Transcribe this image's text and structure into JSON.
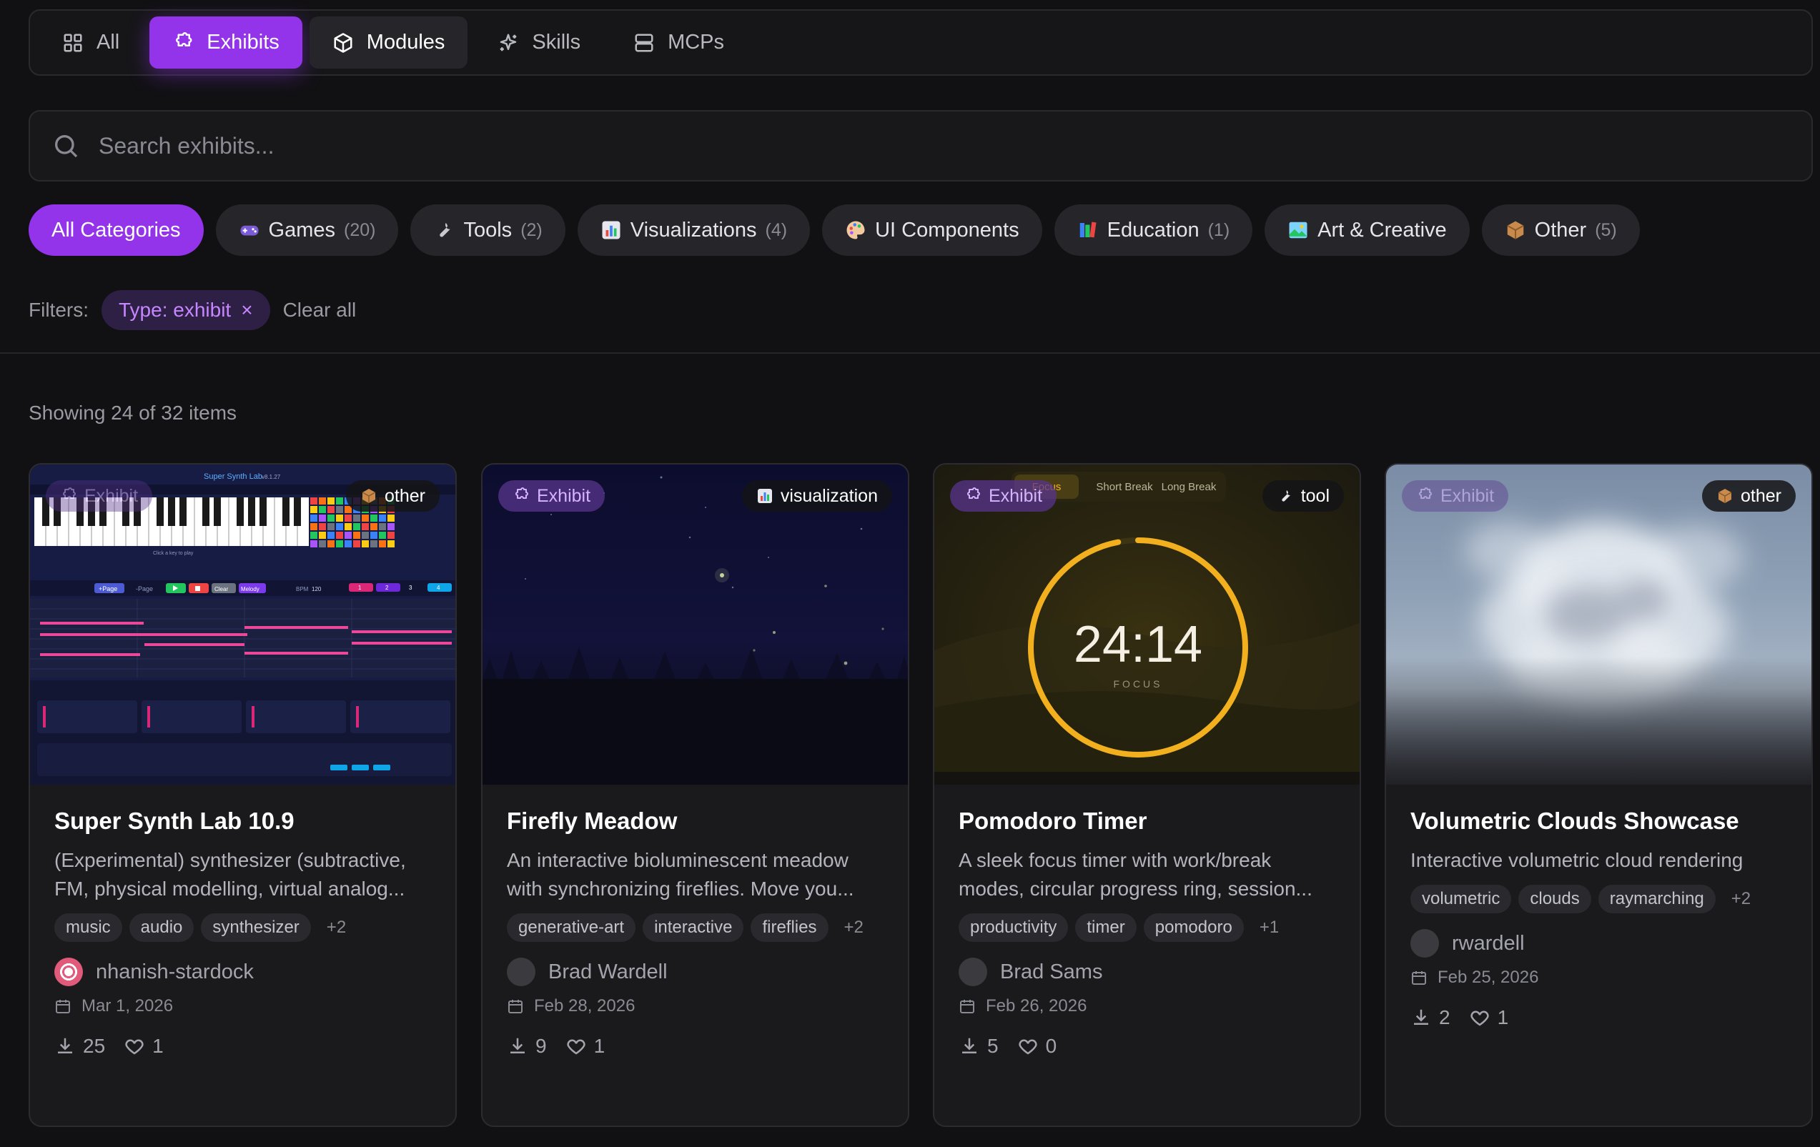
{
  "type_tabs": [
    {
      "label": "All",
      "icon": "grid-icon"
    },
    {
      "label": "Exhibits",
      "icon": "puzzle-icon"
    },
    {
      "label": "Modules",
      "icon": "box-icon"
    },
    {
      "label": "Skills",
      "icon": "sparkles-icon"
    },
    {
      "label": "MCPs",
      "icon": "server-icon"
    }
  ],
  "search": {
    "placeholder": "Search exhibits..."
  },
  "categories": [
    {
      "label": "All Categories",
      "count": ""
    },
    {
      "label": "Games",
      "count": "(20)"
    },
    {
      "label": "Tools",
      "count": "(2)"
    },
    {
      "label": "Visualizations",
      "count": "(4)"
    },
    {
      "label": "UI Components",
      "count": ""
    },
    {
      "label": "Education",
      "count": "(1)"
    },
    {
      "label": "Art & Creative",
      "count": ""
    },
    {
      "label": "Other",
      "count": "(5)"
    }
  ],
  "filters": {
    "label": "Filters:",
    "chip": "Type: exhibit",
    "remove": "×",
    "clear_all": "Clear all"
  },
  "showing": "Showing 24 of 32 items",
  "cards": [
    {
      "type_badge": "Exhibit",
      "category_badge": "other",
      "title": "Super Synth Lab 10.9",
      "desc_line1": "(Experimental) synthesizer (subtractive,",
      "desc_line2": "FM, physical modelling, virtual analog...",
      "tags": [
        "music",
        "audio",
        "synthesizer"
      ],
      "more": "+2",
      "author": "nhanish-stardock",
      "date": "Mar 1, 2026",
      "downloads": "25",
      "likes": "1",
      "thumb_text": {
        "title": "Super Synth Lab",
        "version": "v8.1.27",
        "hint": "Click a key to play",
        "page": "+Page",
        "page2": "-Page",
        "clear": "Clear",
        "melody": "Melody",
        "bpm": "BPM",
        "bpm_val": "120",
        "steps": [
          "1",
          "2",
          "3",
          "4"
        ]
      }
    },
    {
      "type_badge": "Exhibit",
      "category_badge": "visualization",
      "title": "Firefly Meadow",
      "desc_line1": "An interactive bioluminescent meadow",
      "desc_line2": "with synchronizing fireflies. Move you...",
      "tags": [
        "generative-art",
        "interactive",
        "fireflies"
      ],
      "more": "+2",
      "author": "Brad Wardell",
      "date": "Feb 28, 2026",
      "downloads": "9",
      "likes": "1"
    },
    {
      "type_badge": "Exhibit",
      "category_badge": "tool",
      "title": "Pomodoro Timer",
      "desc_line1": "A sleek focus timer with work/break",
      "desc_line2": "modes, circular progress ring, session...",
      "tags": [
        "productivity",
        "timer",
        "pomodoro"
      ],
      "more": "+1",
      "author": "Brad Sams",
      "date": "Feb 26, 2026",
      "downloads": "5",
      "likes": "0",
      "thumb_text": {
        "tab1": "Focus",
        "tab2": "Short Break",
        "tab3": "Long Break",
        "time": "24:14",
        "mode": "FOCUS"
      },
      "progress": 0.97
    },
    {
      "type_badge": "Exhibit",
      "category_badge": "other",
      "title": "Volumetric Clouds Showcase",
      "desc_line1": "Interactive volumetric cloud rendering",
      "tags": [
        "volumetric",
        "clouds",
        "raymarching"
      ],
      "more": "+2",
      "author": "rwardell",
      "date": "Feb 25, 2026",
      "downloads": "2",
      "likes": "1"
    }
  ],
  "colors": {
    "accent": "#9333ea",
    "background": "#111113",
    "card": "#1a1a1d",
    "timer_ring": "#f2b01e"
  }
}
